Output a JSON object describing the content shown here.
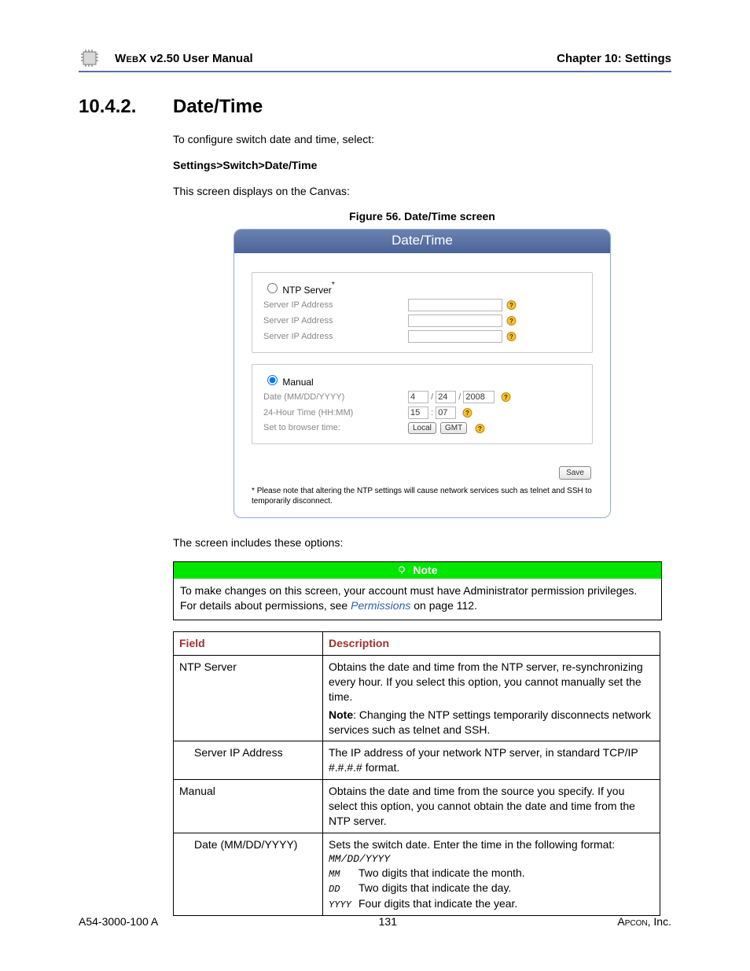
{
  "header": {
    "product": "WebX",
    "version_label": "v2.50 User Manual",
    "chapter": "Chapter 10: Settings"
  },
  "section": {
    "number": "10.4.2.",
    "title": "Date/Time"
  },
  "intro": {
    "line1": "To configure switch date and time, select:",
    "path": "Settings>Switch>Date/Time",
    "line2": "This screen displays on the Canvas:",
    "figure_caption": "Figure 56. Date/Time screen"
  },
  "dt_panel": {
    "title": "Date/Time",
    "ntp": {
      "radio_label": "NTP Server",
      "asterisk": "*",
      "rows": [
        {
          "label": "Server IP Address",
          "value": ""
        },
        {
          "label": "Server IP Address",
          "value": ""
        },
        {
          "label": "Server IP Address",
          "value": ""
        }
      ]
    },
    "manual": {
      "radio_label": "Manual",
      "date_label": "Date (MM/DD/YYYY)",
      "date_mm": "4",
      "date_dd": "24",
      "date_yyyy": "2008",
      "slash": "/",
      "time_label": "24-Hour Time (HH:MM)",
      "time_hh": "15",
      "time_mm": "07",
      "colon": ":",
      "browser_label": "Set to browser time:",
      "local_btn": "Local",
      "gmt_btn": "GMT"
    },
    "save_btn": "Save",
    "footnote_ast": "*",
    "footnote": "Please note that altering the NTP settings will cause network services such as telnet and SSH to temporarily disconnect."
  },
  "after_fig": "The screen includes these options:",
  "note": {
    "title": "Note",
    "body_pre": "To make changes on this screen, your account must have Administrator permission privileges. For details about permissions, see ",
    "link": "Permissions",
    "body_post": " on page 112."
  },
  "table": {
    "headers": {
      "field": "Field",
      "desc": "Description"
    },
    "rows": [
      {
        "field": "NTP Server",
        "desc": "Obtains the date and time from the NTP server, re-synchronizing every hour. If you select this option, you cannot manually set the time.",
        "note_bold": "Note",
        "note_rest": ": Changing the NTP settings temporarily disconnects network services such as telnet and SSH."
      },
      {
        "field": "Server IP Address",
        "indent": true,
        "desc": "The IP address of your network NTP server, in standard TCP/IP #.#.#.# format."
      },
      {
        "field": "Manual",
        "desc": "Obtains the date and time from the source you specify. If you select this option, you cannot obtain the date and time from the NTP server."
      },
      {
        "field": "Date (MM/DD/YYYY)",
        "indent": true,
        "desc": "Sets the switch date. Enter the time in the following format:",
        "fmt": "MM/DD/YYYY",
        "parts": [
          {
            "code": "MM",
            "text": "Two digits that indicate the month."
          },
          {
            "code": "DD",
            "text": "Two digits that indicate the day."
          },
          {
            "code": "YYYY",
            "text": "Four digits that indicate the year."
          }
        ]
      }
    ]
  },
  "footer": {
    "left": "A54-3000-100 A",
    "center": "131",
    "right_pre": "Apcon",
    "right_post": ", Inc."
  }
}
